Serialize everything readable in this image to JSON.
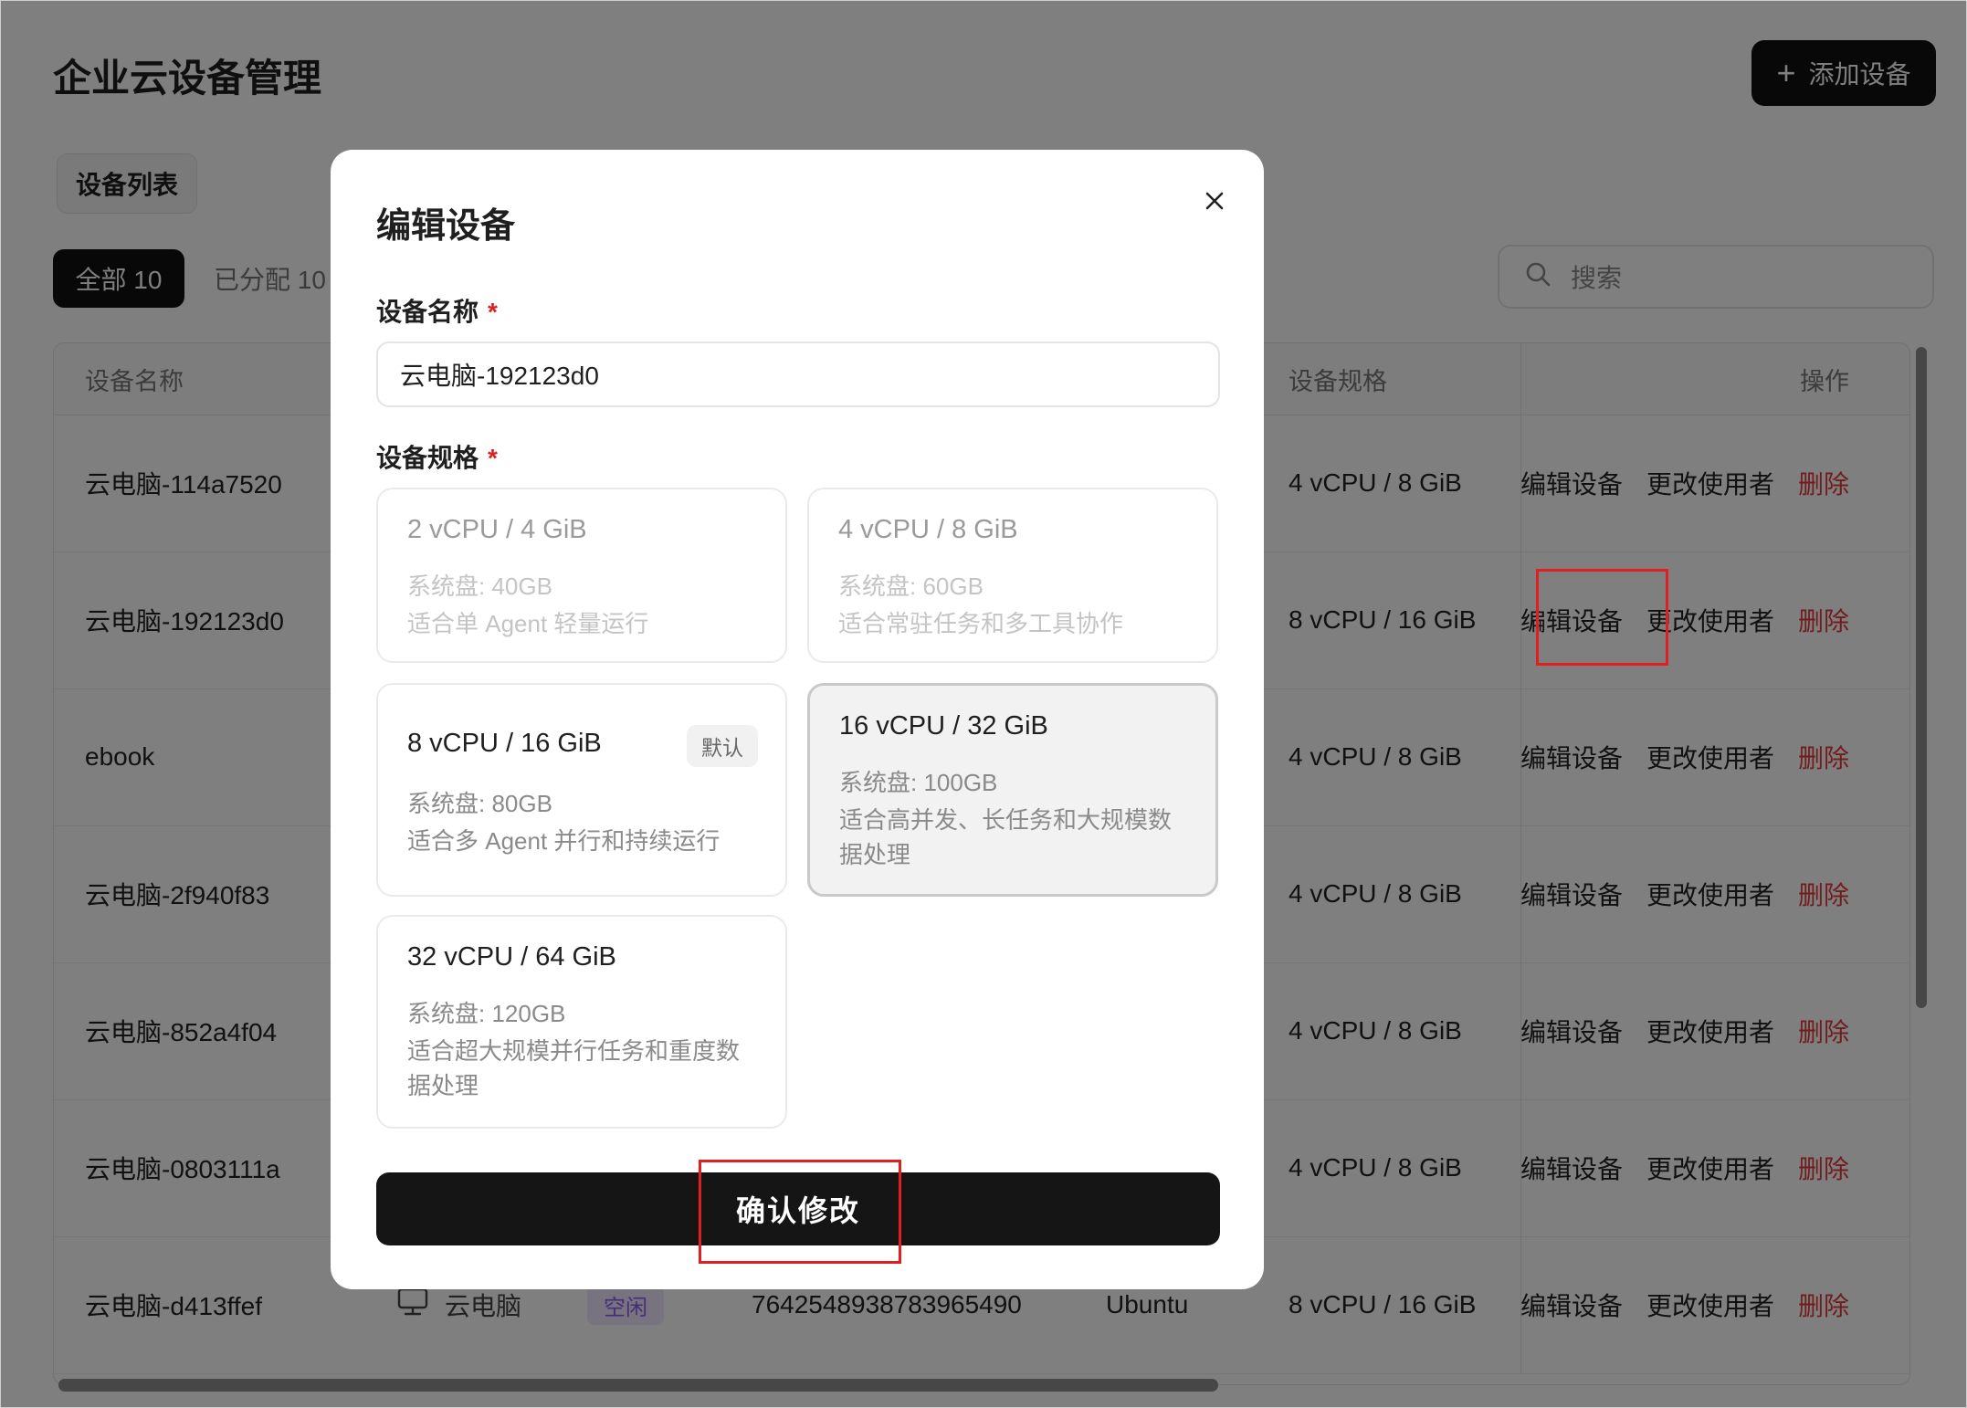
{
  "page": {
    "title": "企业云设备管理",
    "add_button": "添加设备",
    "tag_label": "设备列表",
    "filters": {
      "all": "全部 10",
      "assigned": "已分配 10"
    },
    "search_placeholder": "搜索"
  },
  "table": {
    "headers": {
      "name": "设备名称",
      "spec": "设备规格",
      "ops": "操作"
    },
    "ops": {
      "edit": "编辑设备",
      "change_user": "更改使用者",
      "delete": "删除"
    },
    "rows": [
      {
        "name": "云电脑-114a7520",
        "spec": "4 vCPU / 8 GiB"
      },
      {
        "name": "云电脑-192123d0",
        "spec": "8 vCPU / 16 GiB"
      },
      {
        "name": "ebook",
        "spec": "4 vCPU / 8 GiB"
      },
      {
        "name": "云电脑-2f940f83",
        "spec": "4 vCPU / 8 GiB"
      },
      {
        "name": "云电脑-852a4f04",
        "spec": "4 vCPU / 8 GiB"
      },
      {
        "name": "云电脑-0803111a",
        "spec": "4 vCPU / 8 GiB"
      },
      {
        "name": "云电脑-d413ffef",
        "type": "云电脑",
        "status": "空闲",
        "id": "7642548938783965490",
        "os": "Ubuntu",
        "spec": "8 vCPU / 16 GiB"
      }
    ]
  },
  "modal": {
    "title": "编辑设备",
    "name_label": "设备名称",
    "name_value": "云电脑-192123d0",
    "spec_label": "设备规格",
    "required_mark": "*",
    "specs": [
      {
        "title": "2 vCPU / 4 GiB",
        "disk": "系统盘: 40GB",
        "desc": "适合单 Agent 轻量运行",
        "state": "disabled"
      },
      {
        "title": "4 vCPU / 8 GiB",
        "disk": "系统盘: 60GB",
        "desc": "适合常驻任务和多工具协作",
        "state": "disabled"
      },
      {
        "title": "8 vCPU / 16 GiB",
        "disk": "系统盘: 80GB",
        "desc": "适合多 Agent 并行和持续运行",
        "badge": "默认",
        "state": "normal"
      },
      {
        "title": "16 vCPU / 32 GiB",
        "disk": "系统盘: 100GB",
        "desc": "适合高并发、长任务和大规模数据处理",
        "state": "selected"
      },
      {
        "title": "32 vCPU / 64 GiB",
        "disk": "系统盘: 120GB",
        "desc": "适合超大规模并行任务和重度数据处理",
        "state": "normal"
      }
    ],
    "confirm_button": "确认修改"
  },
  "colors": {
    "accent": "#111111",
    "danger": "#e23a3a",
    "highlight": "#e02020",
    "status_idle": "#8a5cf6"
  }
}
